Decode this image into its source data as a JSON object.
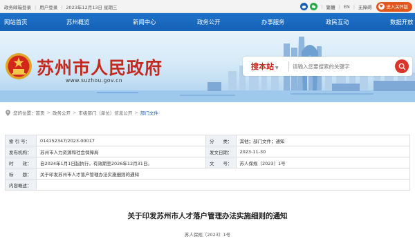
{
  "topbar": {
    "items": [
      "政务邮箱登录",
      "用户登录",
      "2023年12月13日 星期三"
    ],
    "lang_traditional": "繁體",
    "lang_en": "EN",
    "accessibility": "无障碍",
    "care_mode": "进入关怀版"
  },
  "nav": {
    "items": [
      "网站首页",
      "苏州概览",
      "新闻中心",
      "政务公开",
      "办事服务",
      "政民互动",
      "数据开放"
    ]
  },
  "banner": {
    "site_title": "苏州市人民政府",
    "site_url": "www.suzhou.gov.cn"
  },
  "search": {
    "label": "搜本站",
    "placeholder": "请输入您要搜索的关键字"
  },
  "breadcrumb": {
    "prefix": "您的位置：",
    "items": [
      "首页",
      "政务公开",
      "市级部门（单位）信息公开",
      "部门文件"
    ]
  },
  "info_table": {
    "index_label": "索 引 号：",
    "index_value": "014152347/2023-00017",
    "category_label": "分　　类：",
    "category_value": "其他；部门文件；通知",
    "issuer_label": "发布机构：",
    "issuer_value": "苏州市人力资源和社会保障局",
    "date_label": "发文日期：",
    "date_value": "2023-11-30",
    "validity_label": "时　　效：",
    "validity_value": "自2024年1月1日起执行，有效期至2026年12月31日。",
    "docno_label": "文　　号：",
    "docno_value": "苏人保规〔2023〕1号",
    "title_label": "标　　题：",
    "title_value": "关于印发苏州市人才落户管理办法实施细则的通知",
    "content_label": "内容概述："
  },
  "document": {
    "title": "关于印发苏州市人才落户管理办法实施细则的通知",
    "number": "苏人保规〔2023〕1号"
  },
  "colors": {
    "nav_blue": "#1a67bd",
    "title_red": "#c32a1f",
    "care_orange": "#e2571e"
  }
}
